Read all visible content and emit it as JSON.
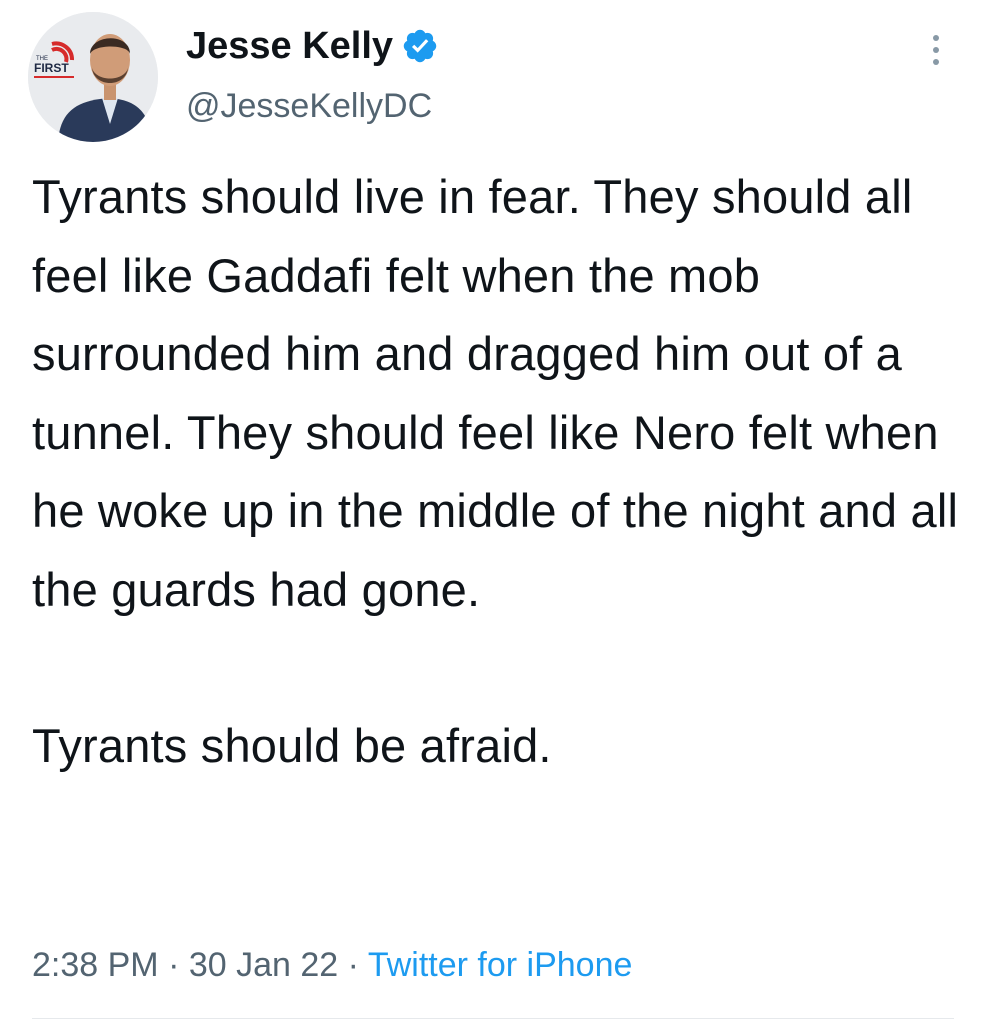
{
  "author": {
    "display_name": "Jesse Kelly",
    "handle": "@JesseKellyDC",
    "verified": true,
    "avatar_logo_text": "FIRST",
    "avatar_logo_small": "THE"
  },
  "tweet": {
    "paragraphs": [
      "Tyrants should live in fear. They should all feel like Gaddafi felt when the mob surrounded him and dragged him out of a tunnel. They should feel like Nero felt when he woke up in the middle of the night and all the guards had gone.",
      "Tyrants should be afraid."
    ]
  },
  "meta": {
    "time": "2:38 PM",
    "separator": "·",
    "date": "30 Jan 22",
    "source": "Twitter for iPhone"
  },
  "colors": {
    "accent": "#1d9bf0",
    "secondary_text": "#536471",
    "primary_text": "#0f1419"
  },
  "icons": {
    "verified": "verified-badge-icon",
    "more": "more-options-icon"
  }
}
